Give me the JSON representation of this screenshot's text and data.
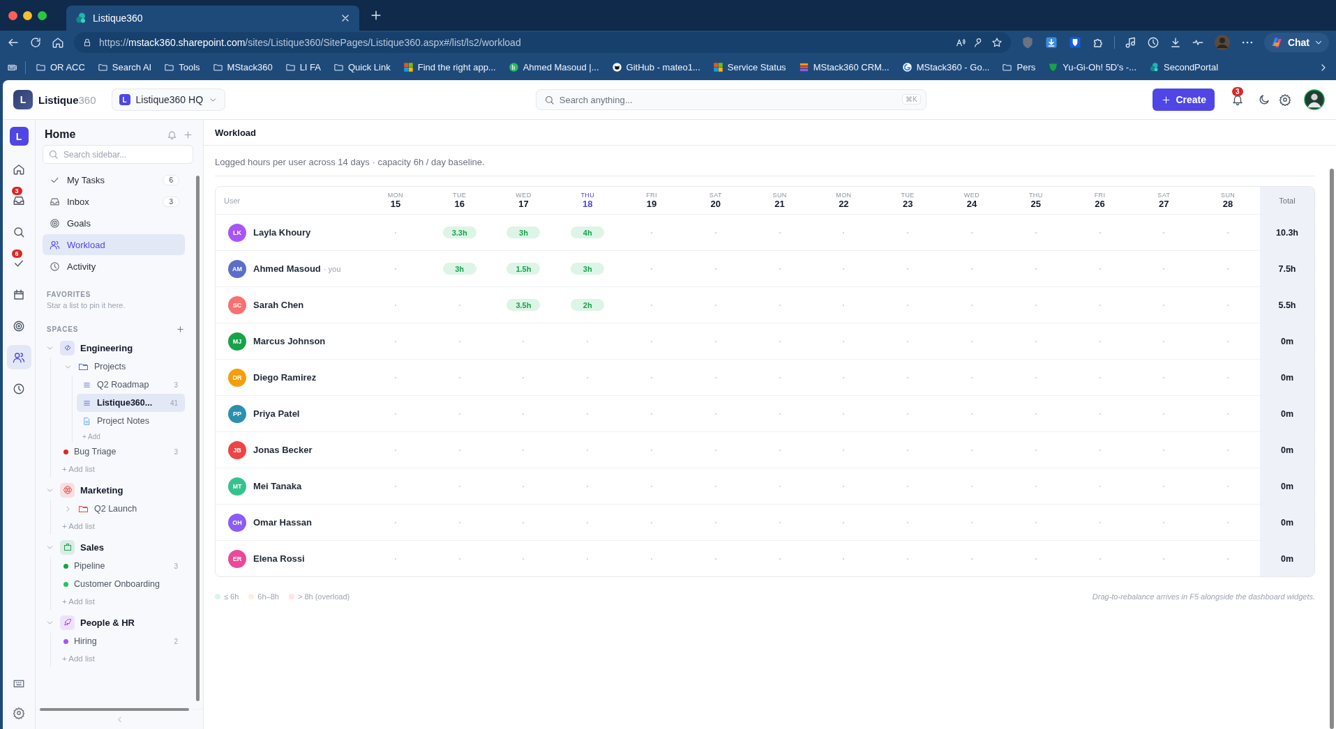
{
  "browser": {
    "tabs": [
      {
        "title": "Listique360",
        "selected": true
      }
    ],
    "url": {
      "scheme": "https://",
      "host": "mstack360.sharepoint.com",
      "path": "/sites/Listique360/SitePages/Listique360.aspx#/list/ls2/workload"
    },
    "chat_label": "Chat",
    "bookmarks": [
      {
        "label": "OR ACC",
        "kind": "folder"
      },
      {
        "label": "Search AI",
        "kind": "folder"
      },
      {
        "label": "Tools",
        "kind": "folder"
      },
      {
        "label": "MStack360",
        "kind": "folder"
      },
      {
        "label": "LI FA",
        "kind": "folder"
      },
      {
        "label": "Quick Link",
        "kind": "folder"
      },
      {
        "label": "Find the right app...",
        "kind": "tiles"
      },
      {
        "label": "Ahmed Masoud |...",
        "kind": "green-circle"
      },
      {
        "label": "GitHub - mateo1...",
        "kind": "octocat"
      },
      {
        "label": "Service Status",
        "kind": "tiles"
      },
      {
        "label": "MStack360 CRM...",
        "kind": "stack"
      },
      {
        "label": "MStack360 - Go...",
        "kind": "g-circle"
      },
      {
        "label": "Pers",
        "kind": "folder"
      },
      {
        "label": "Yu-Gi-Oh! 5D's -...",
        "kind": "shield"
      },
      {
        "label": "SecondPortal",
        "kind": "teal-circle"
      }
    ]
  },
  "app_header": {
    "logo_letter": "L",
    "brand": "Listique",
    "brand_suffix": "360",
    "workspace": {
      "letter": "L",
      "name": "Listique360 HQ"
    },
    "search": {
      "placeholder": "Search anything...",
      "shortcut": "⌘K"
    },
    "create_label": "Create",
    "notification_count": "3"
  },
  "rail": {
    "logo_letter": "L",
    "items": [
      {
        "kind": "home",
        "selected": false
      },
      {
        "kind": "inbox",
        "badge": "3",
        "selected": false
      },
      {
        "kind": "search",
        "selected": false
      },
      {
        "kind": "check",
        "badge": "6",
        "selected": false
      },
      {
        "kind": "calendar",
        "selected": false
      },
      {
        "kind": "target",
        "selected": false
      },
      {
        "kind": "people",
        "selected": true
      },
      {
        "kind": "clock",
        "selected": false
      }
    ],
    "bottom": [
      {
        "kind": "keyboard"
      },
      {
        "kind": "gear"
      }
    ]
  },
  "sidebar": {
    "title": "Home",
    "search_placeholder": "Search sidebar...",
    "nav": [
      {
        "label": "My Tasks",
        "kind": "check",
        "count": "6",
        "selected": false
      },
      {
        "label": "Inbox",
        "kind": "inbox",
        "count": "3",
        "selected": false
      },
      {
        "label": "Goals",
        "kind": "target",
        "selected": false
      },
      {
        "label": "Workload",
        "kind": "people",
        "selected": true
      },
      {
        "label": "Activity",
        "kind": "clock",
        "selected": false
      }
    ],
    "favorites": {
      "heading": "FAVORITES",
      "empty_text": "Star a list to pin it here."
    },
    "spaces_heading": "SPACES",
    "spaces": [
      {
        "name": "Engineering",
        "kind": "code",
        "color": "#4f6bd8",
        "expanded": true,
        "children": [
          {
            "kind": "folder",
            "label": "Projects",
            "color": "#4f6bd8",
            "expanded": true,
            "selected": false,
            "children": [
              {
                "kind": "list",
                "label": "Q2 Roadmap",
                "count": "3",
                "selected": false
              },
              {
                "kind": "list",
                "label": "Listique360...",
                "count": "41",
                "selected": true
              },
              {
                "kind": "doc",
                "label": "Project Notes",
                "selected": false
              },
              {
                "kind": "add",
                "label": "+ Add"
              }
            ]
          },
          {
            "kind": "dot",
            "label": "Bug Triage",
            "color": "#dc2626",
            "count": "3",
            "selected": false
          },
          {
            "kind": "add",
            "label": "+ Add list"
          }
        ]
      },
      {
        "name": "Marketing",
        "kind": "target",
        "color": "#ef4444",
        "expanded": true,
        "children": [
          {
            "kind": "folder",
            "label": "Q2 Launch",
            "color": "#ef4444",
            "expanded": false,
            "selected": false
          },
          {
            "kind": "add",
            "label": "+ Add list"
          }
        ]
      },
      {
        "name": "Sales",
        "kind": "briefcase",
        "color": "#16a34a",
        "expanded": true,
        "children": [
          {
            "kind": "dot",
            "label": "Pipeline",
            "color": "#16a34a",
            "count": "3",
            "selected": false
          },
          {
            "kind": "dot",
            "label": "Customer Onboarding",
            "color": "#22c55e",
            "selected": false
          },
          {
            "kind": "add",
            "label": "+ Add list"
          }
        ]
      },
      {
        "name": "People & HR",
        "kind": "feather",
        "color": "#a855f7",
        "expanded": true,
        "children": [
          {
            "kind": "dot",
            "label": "Hiring",
            "color": "#a855f7",
            "count": "2",
            "selected": false
          },
          {
            "kind": "add",
            "label": "+ Add list"
          }
        ]
      }
    ]
  },
  "main": {
    "breadcrumb": "Workload",
    "subtitle": "Logged hours per user across 14 days · capacity 6h / day baseline.",
    "table": {
      "user_header": "User",
      "total_header": "Total",
      "days": [
        {
          "weekday": "MON",
          "date": "15",
          "today": false
        },
        {
          "weekday": "TUE",
          "date": "16",
          "today": false
        },
        {
          "weekday": "WED",
          "date": "17",
          "today": false
        },
        {
          "weekday": "THU",
          "date": "18",
          "today": true
        },
        {
          "weekday": "FRI",
          "date": "19",
          "today": false
        },
        {
          "weekday": "SAT",
          "date": "20",
          "today": false
        },
        {
          "weekday": "SUN",
          "date": "21",
          "today": false
        },
        {
          "weekday": "MON",
          "date": "22",
          "today": false
        },
        {
          "weekday": "TUE",
          "date": "23",
          "today": false
        },
        {
          "weekday": "WED",
          "date": "24",
          "today": false
        },
        {
          "weekday": "THU",
          "date": "25",
          "today": false
        },
        {
          "weekday": "FRI",
          "date": "26",
          "today": false
        },
        {
          "weekday": "SAT",
          "date": "27",
          "today": false
        },
        {
          "weekday": "SUN",
          "date": "28",
          "today": false
        }
      ],
      "rows": [
        {
          "initials": "LK",
          "name": "Layla Khoury",
          "color": "#a855f7",
          "cells": [
            {
              "kind": "empty"
            },
            {
              "kind": "hours",
              "text": "3.3h"
            },
            {
              "kind": "hours",
              "text": "3h"
            },
            {
              "kind": "hours",
              "text": "4h"
            },
            {
              "kind": "empty"
            },
            {
              "kind": "empty"
            },
            {
              "kind": "empty"
            },
            {
              "kind": "empty"
            },
            {
              "kind": "empty"
            },
            {
              "kind": "empty"
            },
            {
              "kind": "empty"
            },
            {
              "kind": "empty"
            },
            {
              "kind": "empty"
            },
            {
              "kind": "empty"
            }
          ],
          "total": "10.3h"
        },
        {
          "initials": "AM",
          "name": "Ahmed Masoud",
          "note": "· you",
          "color": "#5b6fc9",
          "cells": [
            {
              "kind": "empty"
            },
            {
              "kind": "hours",
              "text": "3h"
            },
            {
              "kind": "hours",
              "text": "1.5h"
            },
            {
              "kind": "hours",
              "text": "3h"
            },
            {
              "kind": "empty"
            },
            {
              "kind": "empty"
            },
            {
              "kind": "empty"
            },
            {
              "kind": "empty"
            },
            {
              "kind": "empty"
            },
            {
              "kind": "empty"
            },
            {
              "kind": "empty"
            },
            {
              "kind": "empty"
            },
            {
              "kind": "empty"
            },
            {
              "kind": "empty"
            }
          ],
          "total": "7.5h"
        },
        {
          "initials": "SC",
          "name": "Sarah Chen",
          "color": "#f87171",
          "cells": [
            {
              "kind": "empty"
            },
            {
              "kind": "empty"
            },
            {
              "kind": "hours",
              "text": "3.5h"
            },
            {
              "kind": "hours",
              "text": "2h"
            },
            {
              "kind": "empty"
            },
            {
              "kind": "empty"
            },
            {
              "kind": "empty"
            },
            {
              "kind": "empty"
            },
            {
              "kind": "empty"
            },
            {
              "kind": "empty"
            },
            {
              "kind": "empty"
            },
            {
              "kind": "empty"
            },
            {
              "kind": "empty"
            },
            {
              "kind": "empty"
            }
          ],
          "total": "5.5h"
        },
        {
          "initials": "MJ",
          "name": "Marcus Johnson",
          "color": "#16a34a",
          "cells": [
            {
              "kind": "empty"
            },
            {
              "kind": "empty"
            },
            {
              "kind": "empty"
            },
            {
              "kind": "empty"
            },
            {
              "kind": "empty"
            },
            {
              "kind": "empty"
            },
            {
              "kind": "empty"
            },
            {
              "kind": "empty"
            },
            {
              "kind": "empty"
            },
            {
              "kind": "empty"
            },
            {
              "kind": "empty"
            },
            {
              "kind": "empty"
            },
            {
              "kind": "empty"
            },
            {
              "kind": "empty"
            }
          ],
          "total": "0m"
        },
        {
          "initials": "DR",
          "name": "Diego Ramirez",
          "color": "#f59e0b",
          "cells": [
            {
              "kind": "empty"
            },
            {
              "kind": "empty"
            },
            {
              "kind": "empty"
            },
            {
              "kind": "empty"
            },
            {
              "kind": "empty"
            },
            {
              "kind": "empty"
            },
            {
              "kind": "empty"
            },
            {
              "kind": "empty"
            },
            {
              "kind": "empty"
            },
            {
              "kind": "empty"
            },
            {
              "kind": "empty"
            },
            {
              "kind": "empty"
            },
            {
              "kind": "empty"
            },
            {
              "kind": "empty"
            }
          ],
          "total": "0m"
        },
        {
          "initials": "PP",
          "name": "Priya Patel",
          "color": "#2b8fb0",
          "cells": [
            {
              "kind": "empty"
            },
            {
              "kind": "empty"
            },
            {
              "kind": "empty"
            },
            {
              "kind": "empty"
            },
            {
              "kind": "empty"
            },
            {
              "kind": "empty"
            },
            {
              "kind": "empty"
            },
            {
              "kind": "empty"
            },
            {
              "kind": "empty"
            },
            {
              "kind": "empty"
            },
            {
              "kind": "empty"
            },
            {
              "kind": "empty"
            },
            {
              "kind": "empty"
            },
            {
              "kind": "empty"
            }
          ],
          "total": "0m"
        },
        {
          "initials": "JB",
          "name": "Jonas Becker",
          "color": "#ef4444",
          "cells": [
            {
              "kind": "empty"
            },
            {
              "kind": "empty"
            },
            {
              "kind": "empty"
            },
            {
              "kind": "empty"
            },
            {
              "kind": "empty"
            },
            {
              "kind": "empty"
            },
            {
              "kind": "empty"
            },
            {
              "kind": "empty"
            },
            {
              "kind": "empty"
            },
            {
              "kind": "empty"
            },
            {
              "kind": "empty"
            },
            {
              "kind": "empty"
            },
            {
              "kind": "empty"
            },
            {
              "kind": "empty"
            }
          ],
          "total": "0m"
        },
        {
          "initials": "MT",
          "name": "Mei Tanaka",
          "color": "#34c38f",
          "cells": [
            {
              "kind": "empty"
            },
            {
              "kind": "empty"
            },
            {
              "kind": "empty"
            },
            {
              "kind": "empty"
            },
            {
              "kind": "empty"
            },
            {
              "kind": "empty"
            },
            {
              "kind": "empty"
            },
            {
              "kind": "empty"
            },
            {
              "kind": "empty"
            },
            {
              "kind": "empty"
            },
            {
              "kind": "empty"
            },
            {
              "kind": "empty"
            },
            {
              "kind": "empty"
            },
            {
              "kind": "empty"
            }
          ],
          "total": "0m"
        },
        {
          "initials": "OH",
          "name": "Omar Hassan",
          "color": "#8b5cf6",
          "cells": [
            {
              "kind": "empty"
            },
            {
              "kind": "empty"
            },
            {
              "kind": "empty"
            },
            {
              "kind": "empty"
            },
            {
              "kind": "empty"
            },
            {
              "kind": "empty"
            },
            {
              "kind": "empty"
            },
            {
              "kind": "empty"
            },
            {
              "kind": "empty"
            },
            {
              "kind": "empty"
            },
            {
              "kind": "empty"
            },
            {
              "kind": "empty"
            },
            {
              "kind": "empty"
            },
            {
              "kind": "empty"
            }
          ],
          "total": "0m"
        },
        {
          "initials": "ER",
          "name": "Elena Rossi",
          "color": "#ec4899",
          "cells": [
            {
              "kind": "empty"
            },
            {
              "kind": "empty"
            },
            {
              "kind": "empty"
            },
            {
              "kind": "empty"
            },
            {
              "kind": "empty"
            },
            {
              "kind": "empty"
            },
            {
              "kind": "empty"
            },
            {
              "kind": "empty"
            },
            {
              "kind": "empty"
            },
            {
              "kind": "empty"
            },
            {
              "kind": "empty"
            },
            {
              "kind": "empty"
            },
            {
              "kind": "empty"
            },
            {
              "kind": "empty"
            }
          ],
          "total": "0m"
        }
      ]
    },
    "legend": [
      {
        "label": "≤ 6h",
        "color": "#dcf5e6"
      },
      {
        "label": "6h–8h",
        "color": "#fdeede"
      },
      {
        "label": "> 8h (overload)",
        "color": "#fde4e6"
      }
    ],
    "footnote": "Drag-to-rebalance arrives in F5 alongside the dashboard widgets."
  }
}
